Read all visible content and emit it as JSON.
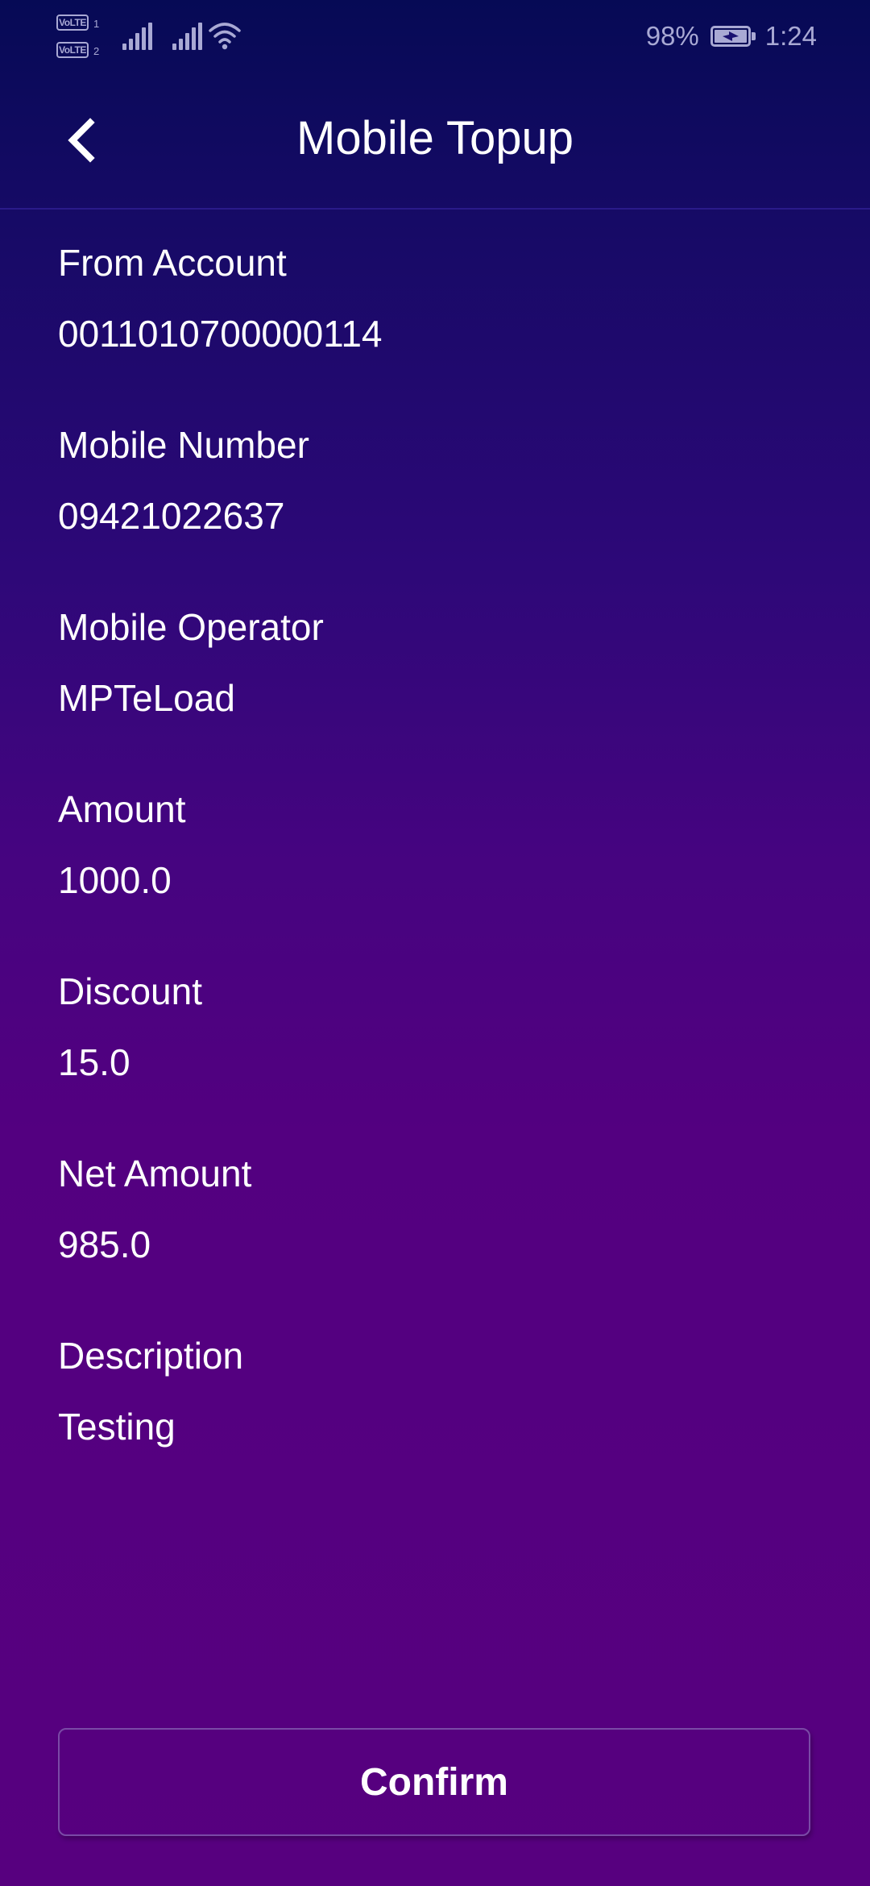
{
  "status_bar": {
    "sim1_tag": "VoLTE",
    "sim1_number": "1",
    "sim2_tag": "VoLTE",
    "sim2_number": "2",
    "battery_percent": "98%",
    "time": "1:24",
    "icons": [
      "volte-icon",
      "signal-icon",
      "signal-icon",
      "wifi-icon",
      "battery-charging-icon"
    ],
    "icon_color": "#a9a9d4"
  },
  "header": {
    "title": "Mobile Topup",
    "back_icon": "chevron-left-icon"
  },
  "fields": [
    {
      "label": "From Account",
      "value": "0011010700000114"
    },
    {
      "label": "Mobile Number",
      "value": "09421022637"
    },
    {
      "label": "Mobile Operator",
      "value": "MPTeLoad"
    },
    {
      "label": "Amount",
      "value": "1000.0"
    },
    {
      "label": "Discount",
      "value": "15.0"
    },
    {
      "label": "Net Amount",
      "value": "985.0"
    },
    {
      "label": "Description",
      "value": "Testing"
    }
  ],
  "actions": {
    "confirm_label": "Confirm"
  },
  "colors": {
    "background_top": "#060a55",
    "background_bottom": "#57007f",
    "text": "#ffffff",
    "button_border": "#7a4aa6"
  }
}
